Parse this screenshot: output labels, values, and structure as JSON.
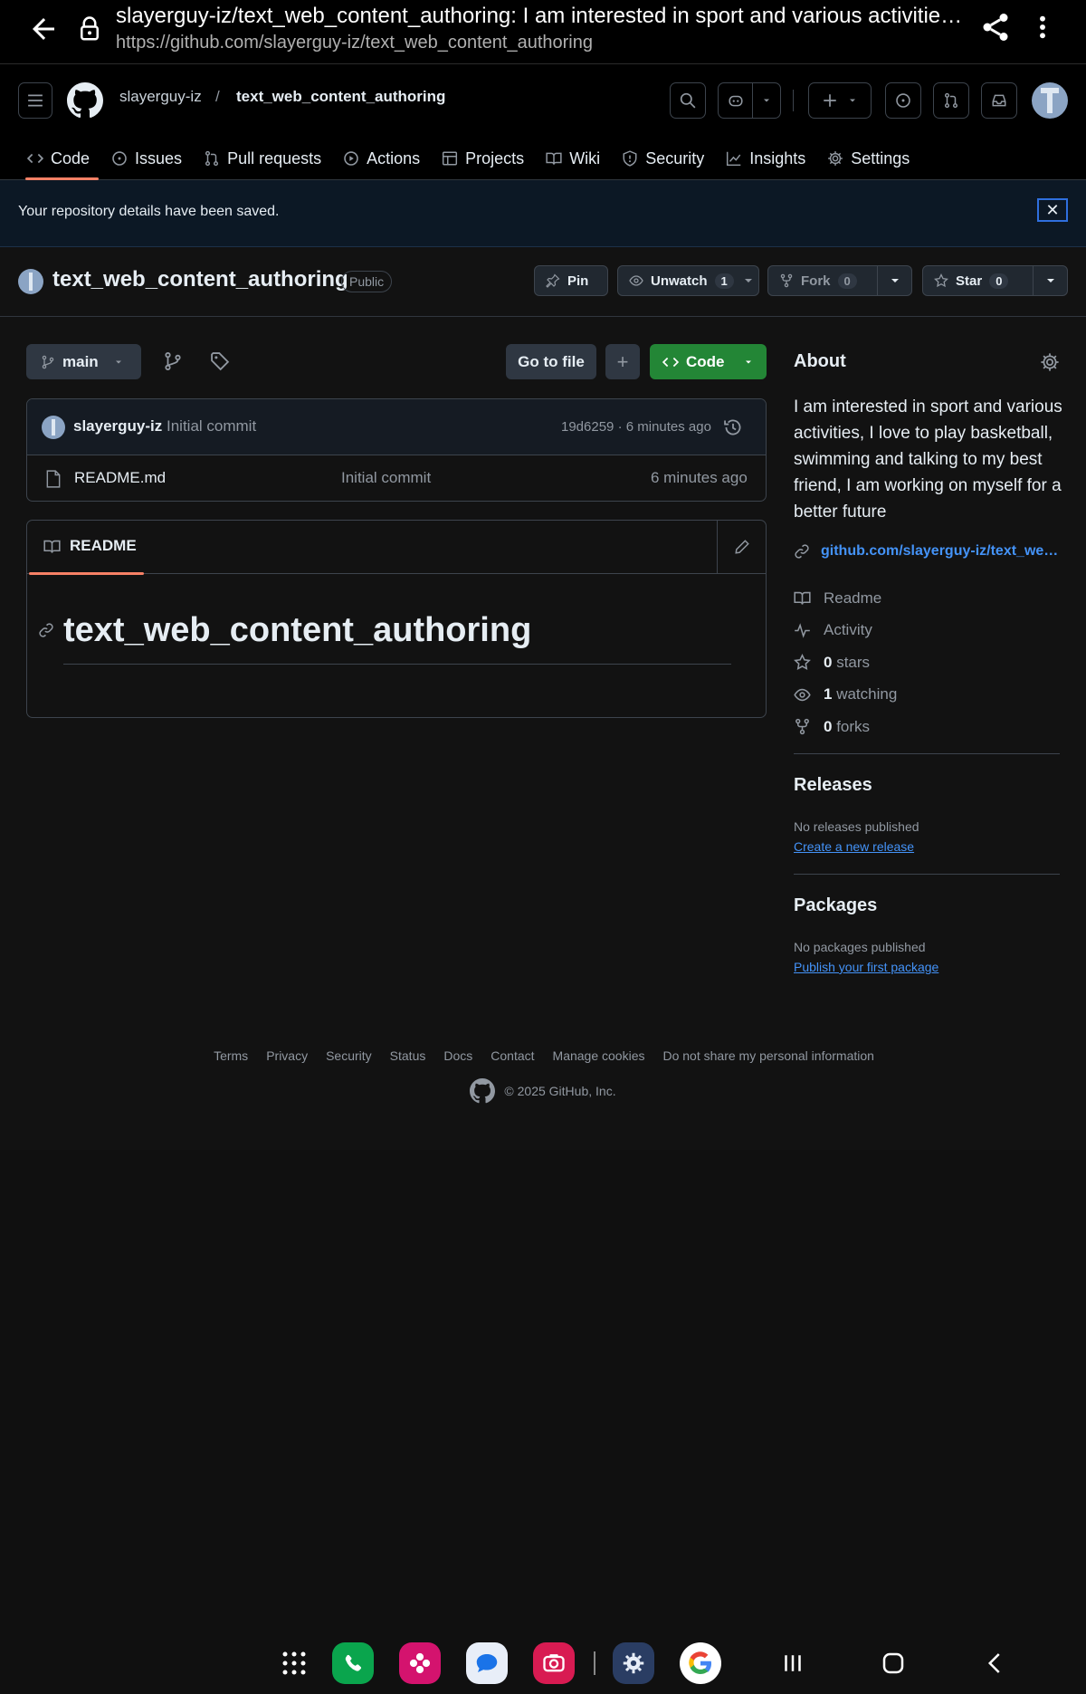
{
  "browser": {
    "title": "slayerguy-iz/text_web_content_authoring: I am interested in sport and various activities, I love to play basketball, swimming and talking to my best friend, I am working on myself for a better future",
    "url": "https://github.com/slayerguy-iz/text_web_content_authoring"
  },
  "header": {
    "owner": "slayerguy-iz",
    "separator": "/",
    "repo": "text_web_content_authoring"
  },
  "tabs": [
    {
      "label": "Code",
      "icon": "code-icon"
    },
    {
      "label": "Issues",
      "icon": "issue-icon"
    },
    {
      "label": "Pull requests",
      "icon": "pull-request-icon"
    },
    {
      "label": "Actions",
      "icon": "play-icon"
    },
    {
      "label": "Projects",
      "icon": "table-icon"
    },
    {
      "label": "Wiki",
      "icon": "book-icon"
    },
    {
      "label": "Security",
      "icon": "shield-icon"
    },
    {
      "label": "Insights",
      "icon": "graph-icon"
    },
    {
      "label": "Settings",
      "icon": "gear-icon"
    }
  ],
  "flash": {
    "message": "Your repository details have been saved.",
    "close": "✕"
  },
  "repo": {
    "name": "text_web_content_authoring",
    "visibility": "Public",
    "pin": "Pin",
    "watch": "Unwatch",
    "watch_count": "1",
    "fork": "Fork",
    "fork_count": "0",
    "star": "Star",
    "star_count": "0"
  },
  "toolbar": {
    "branch": "main",
    "go_to_file": "Go to file",
    "add": "+",
    "code": "Code"
  },
  "commit": {
    "author": "slayerguy-iz",
    "message": "Initial commit",
    "meta": "19d6259 · 6 minutes ago"
  },
  "files": [
    {
      "name": "README.md",
      "commit": "Initial commit",
      "age": "6 minutes ago"
    }
  ],
  "readme": {
    "tab": "README",
    "heading": "text_web_content_authoring"
  },
  "about": {
    "heading": "About",
    "description": "I am interested in sport and various activities, I love to play basketball, swimming and talking to my best friend, I am working on myself for a better future",
    "link": "github.com/slayerguy-iz/text_web_content_authoring",
    "readme": "Readme",
    "activity": "Activity",
    "stars_count": "0",
    "stars_label": "stars",
    "watching_count": "1",
    "watching_label": "watching",
    "forks_count": "0",
    "forks_label": "forks"
  },
  "releases": {
    "heading": "Releases",
    "note": "No releases published",
    "link": "Create a new release"
  },
  "packages": {
    "heading": "Packages",
    "note": "No packages published",
    "link": "Publish your first package"
  },
  "footer": {
    "links": [
      "Terms",
      "Privacy",
      "Security",
      "Status",
      "Docs",
      "Contact",
      "Manage cookies",
      "Do not share my personal information"
    ],
    "copyright": "© 2025 GitHub, Inc."
  },
  "colors": {
    "accent_green": "#238636",
    "link_blue": "#4493f8",
    "tab_underline": "#f78166"
  }
}
